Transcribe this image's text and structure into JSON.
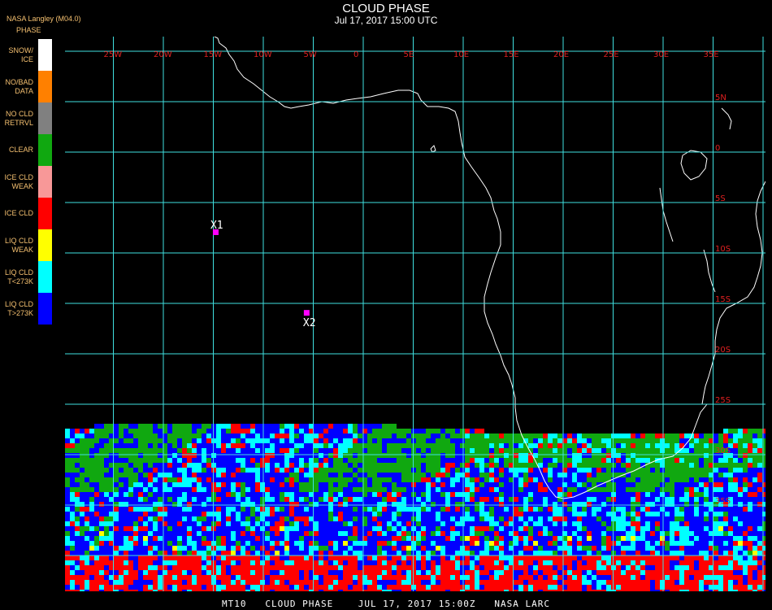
{
  "header": {
    "title": "CLOUD PHASE",
    "subtitle": "Jul 17, 2017 15:00 UTC",
    "producer": "NASA Langley (M04.0)"
  },
  "legend": {
    "title": "PHASE",
    "items": [
      {
        "label": "SNOW/\nICE",
        "color": "#ffffff"
      },
      {
        "label": "NO/BAD\nDATA",
        "color": "#ff8000"
      },
      {
        "label": "NO CLD\nRETRVL",
        "color": "#808080"
      },
      {
        "label": "CLEAR",
        "color": "#10a810"
      },
      {
        "label": "ICE CLD\nWEAK",
        "color": "#f89898"
      },
      {
        "label": "ICE CLD",
        "color": "#ff0000"
      },
      {
        "label": "LIQ CLD\nWEAK",
        "color": "#ffff00"
      },
      {
        "label": "LIQ CLD\nT<273K",
        "color": "#00ffff"
      },
      {
        "label": "LIQ CLD\nT>273K",
        "color": "#0000ff"
      }
    ]
  },
  "map": {
    "lon_labels": [
      "25W",
      "20W",
      "15W",
      "10W",
      "5W",
      "0",
      "5E",
      "10E",
      "15E",
      "20E",
      "25E",
      "30E",
      "35E"
    ],
    "lat_labels": [
      "5N",
      "0",
      "5S",
      "10S",
      "15S",
      "20S",
      "25S",
      "30S",
      "35S"
    ],
    "grid_color": "#40e0e0",
    "coast_color": "#ffffff",
    "markers": [
      {
        "label": "X1",
        "lon": -14.8,
        "lat": -7.9
      },
      {
        "label": "X2",
        "lon": -5.7,
        "lat": -15.9
      }
    ],
    "marker_color": "#ff00ff"
  },
  "footer": {
    "text": "MT10   CLOUD PHASE    JUL 17, 2017 15:00Z   NASA LARC"
  }
}
